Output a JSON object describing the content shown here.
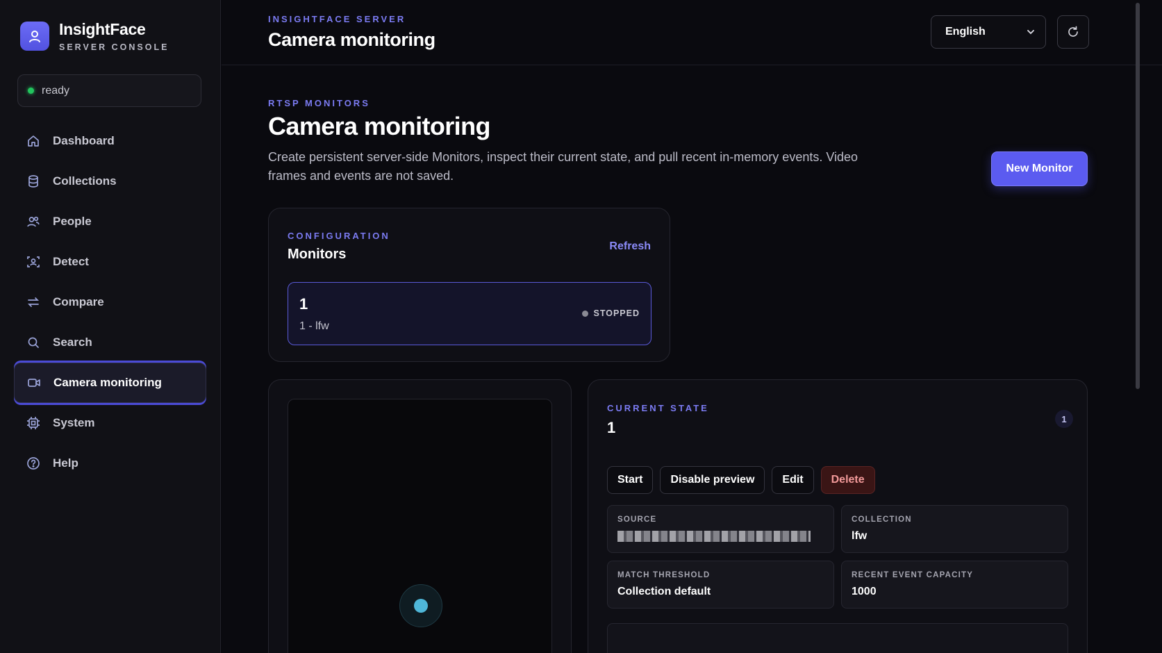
{
  "brand": {
    "name": "InsightFace",
    "subtitle": "SERVER CONSOLE"
  },
  "status": {
    "text": "ready",
    "color": "#22c55e"
  },
  "nav": [
    {
      "label": "Dashboard",
      "icon": "home-icon"
    },
    {
      "label": "Collections",
      "icon": "database-icon"
    },
    {
      "label": "People",
      "icon": "people-icon"
    },
    {
      "label": "Detect",
      "icon": "face-scan-icon"
    },
    {
      "label": "Compare",
      "icon": "arrows-swap-icon"
    },
    {
      "label": "Search",
      "icon": "search-icon"
    },
    {
      "label": "Camera monitoring",
      "icon": "video-camera-icon",
      "active": true
    },
    {
      "label": "System",
      "icon": "cpu-icon"
    },
    {
      "label": "Help",
      "icon": "help-circle-icon"
    }
  ],
  "header": {
    "eyebrow": "INSIGHTFACE SERVER",
    "title": "Camera monitoring",
    "language": "English"
  },
  "hero": {
    "eyebrow": "RTSP MONITORS",
    "title": "Camera monitoring",
    "description": "Create persistent server-side Monitors, inspect their current state, and pull recent in-memory events. Video frames and events are not saved.",
    "new_button": "New Monitor"
  },
  "config": {
    "eyebrow": "CONFIGURATION",
    "title": "Monitors",
    "refresh": "Refresh",
    "monitors": [
      {
        "name": "1",
        "subtitle": "1 - lfw",
        "status": "STOPPED"
      }
    ]
  },
  "state": {
    "eyebrow": "CURRENT STATE",
    "name": "1",
    "badge": "1",
    "actions": {
      "start": "Start",
      "preview": "Disable preview",
      "edit": "Edit",
      "delete": "Delete"
    },
    "fields": {
      "source_label": "SOURCE",
      "collection_label": "COLLECTION",
      "collection_value": "lfw",
      "threshold_label": "MATCH THRESHOLD",
      "threshold_value": "Collection default",
      "capacity_label": "RECENT EVENT CAPACITY",
      "capacity_value": "1000"
    }
  },
  "colors": {
    "accent": "#5b5bf0",
    "background": "#0a0a0f",
    "danger": "#f29a9a"
  }
}
